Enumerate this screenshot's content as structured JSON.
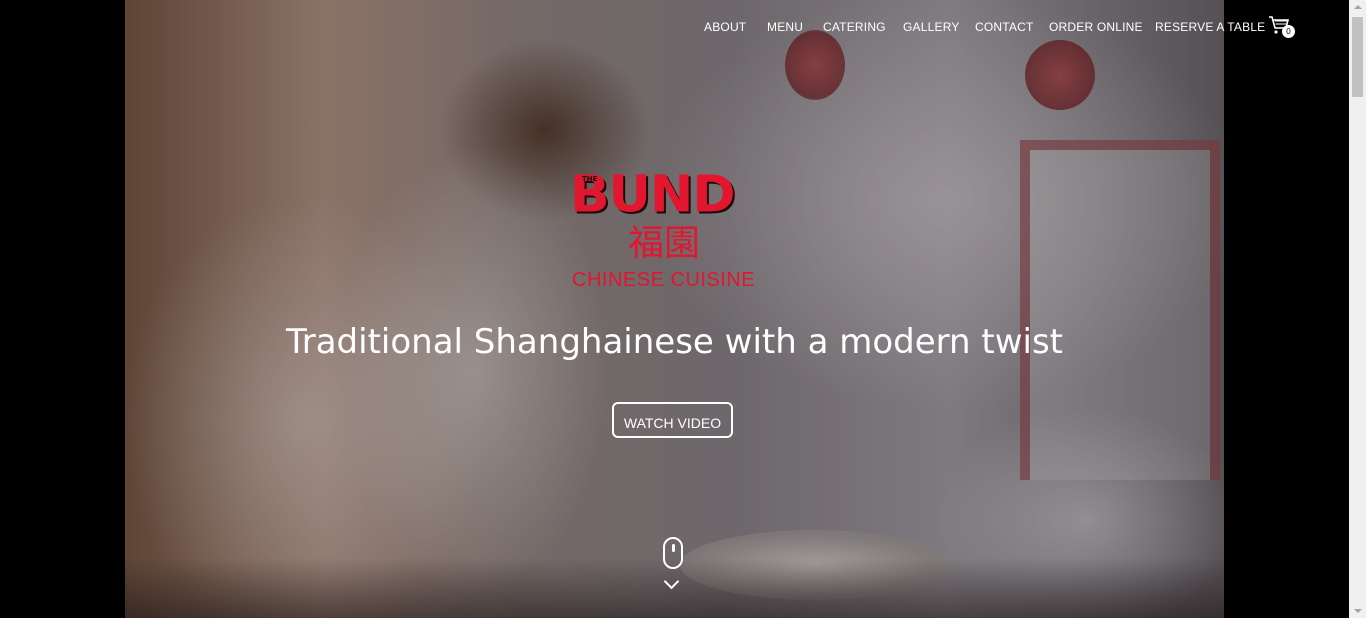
{
  "nav": {
    "items": [
      {
        "label": "ABOUT"
      },
      {
        "label": "MENU"
      },
      {
        "label": "CATERING"
      },
      {
        "label": "GALLERY"
      },
      {
        "label": "CONTACT"
      },
      {
        "label": "ORDER ONLINE"
      },
      {
        "label": "RESERVE A TABLE"
      }
    ],
    "cart": {
      "icon": "shopping-cart-icon",
      "count": "0"
    }
  },
  "logo": {
    "prefix": "THE",
    "name": "BUND",
    "chinese": "福園",
    "subtitle": "CHINESE CUISINE",
    "color": "#e2162f"
  },
  "hero": {
    "tagline": "Traditional Shanghainese with a modern twist",
    "watch_video_label": "WATCH VIDEO",
    "scroll_icons": [
      "mouse-icon",
      "chevron-down-icon"
    ]
  }
}
